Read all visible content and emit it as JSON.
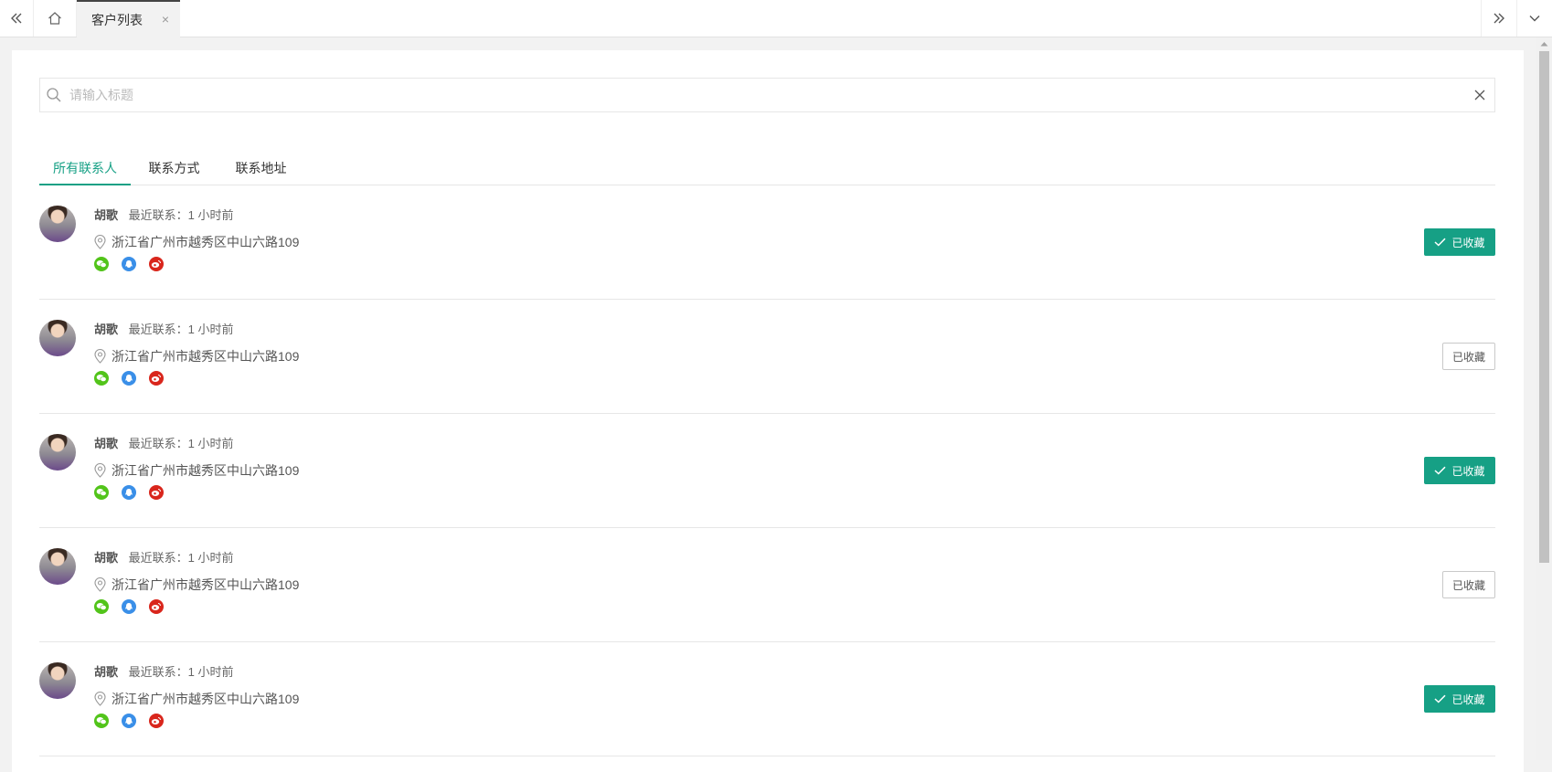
{
  "tabbar": {
    "scroll_left_icon": "double-chevron-left-icon",
    "home_icon": "home-icon",
    "active_tab_label": "客户列表",
    "active_tab_close": "×",
    "scroll_right_icon": "double-chevron-right-icon",
    "more_icon": "chevron-down-icon"
  },
  "search": {
    "placeholder": "请输入标题",
    "value": "",
    "icon": "search-icon",
    "clear_icon": "close-icon"
  },
  "tabs": [
    {
      "label": "所有联系人",
      "active": true
    },
    {
      "label": "联系方式",
      "active": false
    },
    {
      "label": "联系地址",
      "active": false
    }
  ],
  "contacts": [
    {
      "name": "胡歌",
      "last_contact": "最近联系：1 小时前",
      "address": "浙江省广州市越秀区中山六路109",
      "favorite_label": "已收藏",
      "favorited": true
    },
    {
      "name": "胡歌",
      "last_contact": "最近联系：1 小时前",
      "address": "浙江省广州市越秀区中山六路109",
      "favorite_label": "已收藏",
      "favorited": false
    },
    {
      "name": "胡歌",
      "last_contact": "最近联系：1 小时前",
      "address": "浙江省广州市越秀区中山六路109",
      "favorite_label": "已收藏",
      "favorited": true
    },
    {
      "name": "胡歌",
      "last_contact": "最近联系：1 小时前",
      "address": "浙江省广州市越秀区中山六路109",
      "favorite_label": "已收藏",
      "favorited": false
    },
    {
      "name": "胡歌",
      "last_contact": "最近联系：1 小时前",
      "address": "浙江省广州市越秀区中山六路109",
      "favorite_label": "已收藏",
      "favorited": true
    }
  ],
  "social_icons": [
    "wechat-icon",
    "qq-icon",
    "weibo-icon"
  ],
  "colors": {
    "accent": "#16a085",
    "wechat": "#52c41a",
    "qq": "#3a8fe8",
    "weibo": "#d9261c"
  }
}
